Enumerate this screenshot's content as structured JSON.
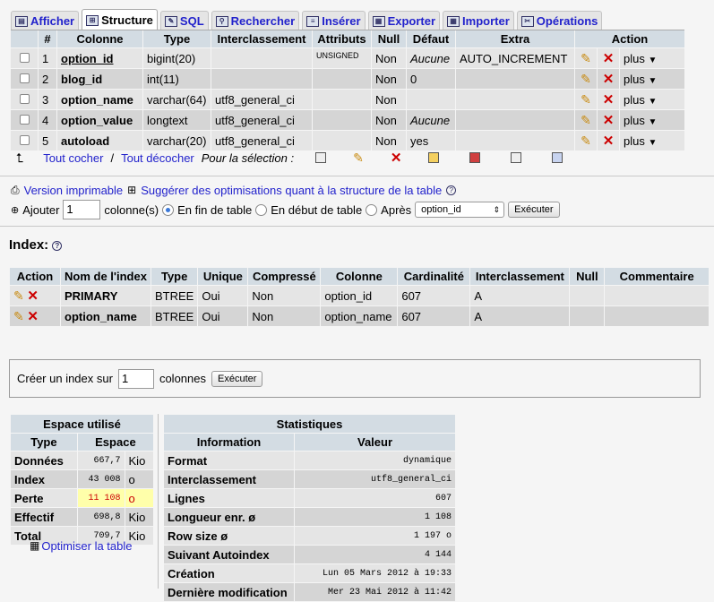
{
  "tabs": [
    {
      "label": "Afficher",
      "icon": "browse-icon",
      "active": false
    },
    {
      "label": "Structure",
      "icon": "structure-icon",
      "active": true
    },
    {
      "label": "SQL",
      "icon": "sql-icon",
      "active": false
    },
    {
      "label": "Rechercher",
      "icon": "search-icon",
      "active": false
    },
    {
      "label": "Insérer",
      "icon": "insert-icon",
      "active": false
    },
    {
      "label": "Exporter",
      "icon": "export-icon",
      "active": false
    },
    {
      "label": "Importer",
      "icon": "import-icon",
      "active": false
    },
    {
      "label": "Opérations",
      "icon": "operations-icon",
      "active": false
    }
  ],
  "structure": {
    "headers": [
      "#",
      "Colonne",
      "Type",
      "Interclassement",
      "Attributs",
      "Null",
      "Défaut",
      "Extra",
      "Action"
    ],
    "rows": [
      {
        "num": "1",
        "name": "option_id",
        "type": "bigint(20)",
        "collation": "",
        "attributes": "UNSIGNED",
        "null": "Non",
        "default": "Aucune",
        "extra": "AUTO_INCREMENT"
      },
      {
        "num": "2",
        "name": "blog_id",
        "type": "int(11)",
        "collation": "",
        "attributes": "",
        "null": "Non",
        "default": "0",
        "extra": ""
      },
      {
        "num": "3",
        "name": "option_name",
        "type": "varchar(64)",
        "collation": "utf8_general_ci",
        "attributes": "",
        "null": "Non",
        "default": "",
        "extra": ""
      },
      {
        "num": "4",
        "name": "option_value",
        "type": "longtext",
        "collation": "utf8_general_ci",
        "attributes": "",
        "null": "Non",
        "default": "Aucune",
        "extra": ""
      },
      {
        "num": "5",
        "name": "autoload",
        "type": "varchar(20)",
        "collation": "utf8_general_ci",
        "attributes": "",
        "null": "Non",
        "default": "yes",
        "extra": ""
      }
    ],
    "more_label": "plus"
  },
  "selection": {
    "check_all": "Tout cocher",
    "separator": "/",
    "uncheck_all": "Tout décocher",
    "for_selection": "Pour la sélection :"
  },
  "links": {
    "print_view": "Version imprimable",
    "propose": "Suggérer des optimisations quant à la structure de la table"
  },
  "add_column": {
    "label": "Ajouter",
    "count": "1",
    "columns_label": "colonne(s)",
    "opt_end": "En fin de table",
    "opt_begin": "En début de table",
    "opt_after": "Après",
    "after_value": "option_id",
    "execute": "Exécuter"
  },
  "indexes": {
    "title": "Index:",
    "headers": [
      "Action",
      "Nom de l'index",
      "Type",
      "Unique",
      "Compressé",
      "Colonne",
      "Cardinalité",
      "Interclassement",
      "Null",
      "Commentaire"
    ],
    "rows": [
      {
        "name": "PRIMARY",
        "type": "BTREE",
        "unique": "Oui",
        "packed": "Non",
        "column": "option_id",
        "cardinality": "607",
        "collation": "A",
        "null": "",
        "comment": ""
      },
      {
        "name": "option_name",
        "type": "BTREE",
        "unique": "Oui",
        "packed": "Non",
        "column": "option_name",
        "cardinality": "607",
        "collation": "A",
        "null": "",
        "comment": ""
      }
    ]
  },
  "create_index": {
    "label": "Créer un index sur",
    "count": "1",
    "columns_label": "colonnes",
    "execute": "Exécuter"
  },
  "space": {
    "title": "Espace utilisé",
    "headers": [
      "Type",
      "Espace"
    ],
    "rows": [
      {
        "type": "Données",
        "value": "667,7",
        "unit": "Kio",
        "warn": false
      },
      {
        "type": "Index",
        "value": "43 008",
        "unit": "o",
        "warn": false
      },
      {
        "type": "Perte",
        "value": "11 108",
        "unit": "o",
        "warn": true
      },
      {
        "type": "Effectif",
        "value": "698,8",
        "unit": "Kio",
        "warn": false
      },
      {
        "type": "Total",
        "value": "709,7",
        "unit": "Kio",
        "warn": false
      }
    ],
    "optimize": "Optimiser la table"
  },
  "stats": {
    "title": "Statistiques",
    "headers": [
      "Information",
      "Valeur"
    ],
    "rows": [
      {
        "info": "Format",
        "value": "dynamique"
      },
      {
        "info": "Interclassement",
        "value": "utf8_general_ci"
      },
      {
        "info": "Lignes",
        "value": "607"
      },
      {
        "info": "Longueur enr. ø",
        "value": "1 108"
      },
      {
        "info": "Row size ø",
        "value": "1 197 o"
      },
      {
        "info": "Suivant Autoindex",
        "value": "4 144"
      },
      {
        "info": "Création",
        "value": "Lun 05 Mars 2012 à 19:33"
      },
      {
        "info": "Dernière modification",
        "value": "Mer 23 Mai 2012 à 11:42"
      }
    ]
  }
}
